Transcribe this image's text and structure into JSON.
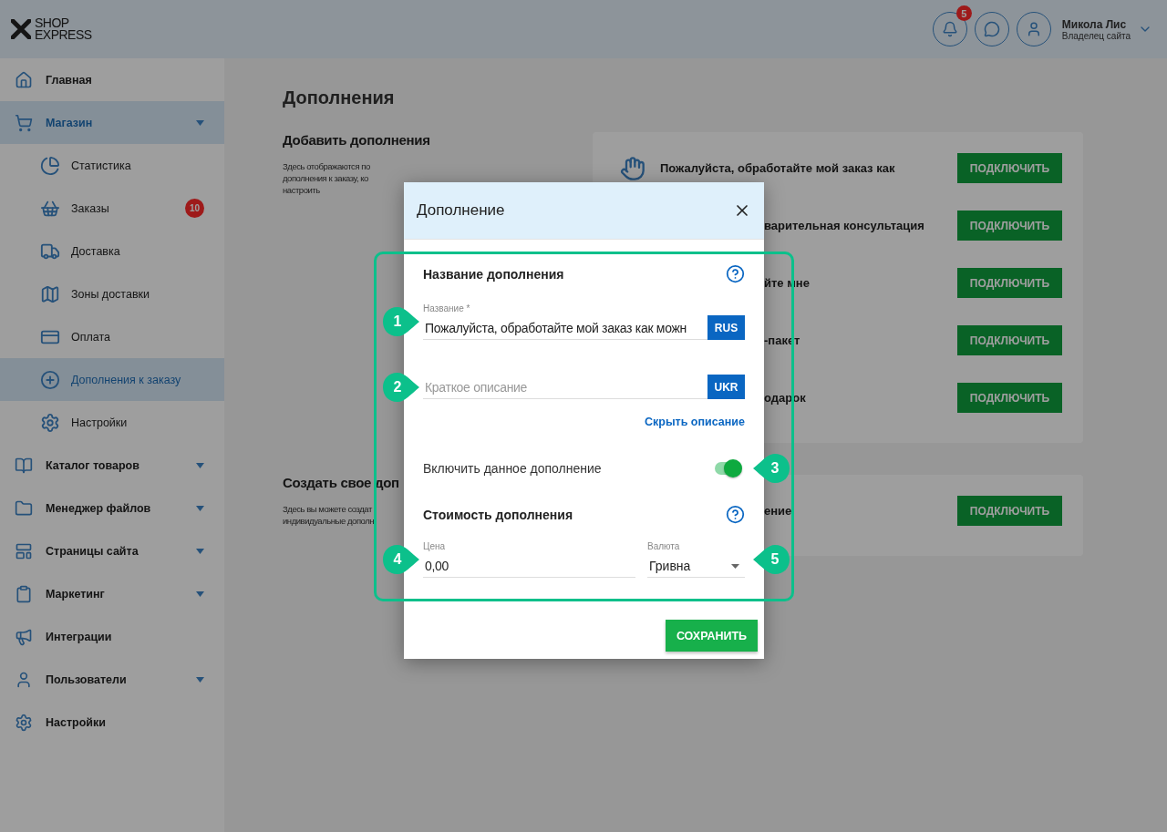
{
  "header": {
    "logo": [
      "SHOP",
      "EXPRESS"
    ],
    "notifications": {
      "count": "5"
    },
    "user": {
      "name": "Микола Лис",
      "role": "Владелец сайта"
    }
  },
  "sidebar": {
    "items": [
      {
        "kind": "link",
        "label": "Главная",
        "selected": false
      },
      {
        "kind": "group",
        "label": "Магазин",
        "selected": true,
        "expanded": true,
        "children": [
          {
            "label": "Статистика",
            "selected": false
          },
          {
            "label": "Заказы",
            "selected": false,
            "badge": "10"
          },
          {
            "label": "Доставка",
            "selected": false
          },
          {
            "label": "Зоны доставки",
            "selected": false
          },
          {
            "label": "Оплата",
            "selected": false
          },
          {
            "label": "Дополнения к заказу",
            "selected": true
          },
          {
            "label": "Настройки",
            "selected": false
          }
        ]
      },
      {
        "kind": "group",
        "label": "Каталог товаров",
        "selected": false
      },
      {
        "kind": "group",
        "label": "Менеджер файлов",
        "selected": false
      },
      {
        "kind": "group",
        "label": "Страницы сайта",
        "selected": false
      },
      {
        "kind": "group",
        "label": "Маркетинг",
        "selected": false
      },
      {
        "kind": "link",
        "label": "Интеграции",
        "selected": false
      },
      {
        "kind": "group",
        "label": "Пользователи",
        "selected": false
      },
      {
        "kind": "link",
        "label": "Настройки",
        "selected": false
      }
    ]
  },
  "page": {
    "title": "Дополнения",
    "add_section": {
      "title": "Добавить дополнения",
      "description": [
        "Здесь отображаются по",
        "дополнения к заказу, ко",
        "настроить"
      ],
      "addons": [
        {
          "kind": "full",
          "name": "Пожалуйста, обработайте мой заказ как",
          "button": "ПОДКЛЮЧИТЬ"
        },
        {
          "kind": "partial",
          "name": "варительная консультация",
          "button": "ПОДКЛЮЧИТЬ"
        },
        {
          "kind": "partial",
          "name": "йте мне",
          "button": "ПОДКЛЮЧИТЬ"
        },
        {
          "kind": "partial",
          "name": "-пакет",
          "button": "ПОДКЛЮЧИТЬ"
        },
        {
          "kind": "partial",
          "name": "одарок",
          "button": "ПОДКЛЮЧИТЬ"
        }
      ]
    },
    "custom_section": {
      "title": "Создать свое доп",
      "description": [
        "Здесь вы можете создат",
        "индивидуальные дополн"
      ],
      "addons": [
        {
          "kind": "partial",
          "name": "ение",
          "button": "ПОДКЛЮЧИТЬ"
        }
      ]
    }
  },
  "modal": {
    "title": "Дополнение",
    "name_section": {
      "title": "Название дополнения",
      "name_field": {
        "label": "Название *",
        "value": "Пожалуйста, обработайте мой заказ как можн",
        "language": "RUS",
        "callout": "1"
      },
      "description_field": {
        "placeholder": "Краткое описание",
        "language": "UKR",
        "callout": "2"
      },
      "hide_link": "Скрыть описание"
    },
    "enable": {
      "label": "Включить данное дополнение",
      "on": true,
      "callout": "3"
    },
    "cost_section": {
      "title": "Стоимость дополнения",
      "price": {
        "label": "Цена",
        "value": "0,00",
        "callout": "4"
      },
      "currency": {
        "label": "Валюта",
        "value": "Гривна",
        "callout": "5"
      }
    },
    "save_button": "СОХРАНИТЬ"
  }
}
